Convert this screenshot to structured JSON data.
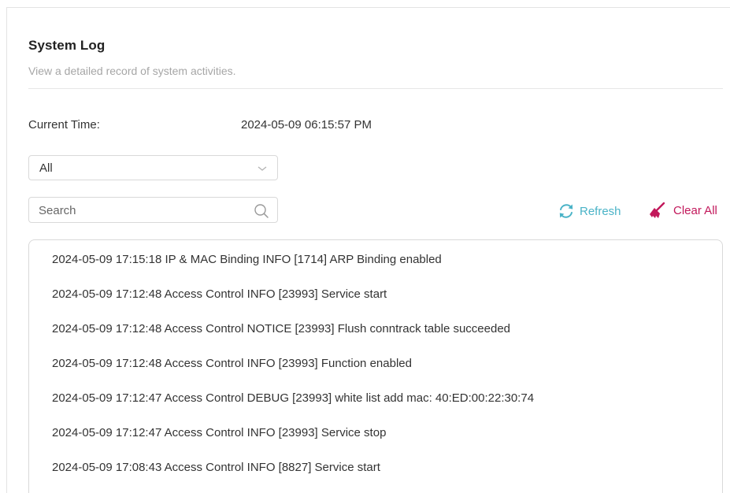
{
  "header": {
    "title": "System Log",
    "subtitle": "View a detailed record of system activities."
  },
  "current_time": {
    "label": "Current Time:",
    "value": "2024-05-09 06:15:57 PM"
  },
  "filter": {
    "selected": "All"
  },
  "search": {
    "placeholder": "Search",
    "value": ""
  },
  "actions": {
    "refresh_label": "Refresh",
    "clear_label": "Clear All"
  },
  "colors": {
    "refresh": "#4ab3c7",
    "clear": "#c2185b"
  },
  "icons": {
    "refresh": "refresh-icon",
    "clear": "broom-icon",
    "search": "search-icon",
    "dropdown": "chevron-down-icon"
  },
  "logs": [
    "2024-05-09 17:15:18 IP & MAC Binding INFO [1714] ARP Binding enabled",
    "2024-05-09 17:12:48 Access Control INFO [23993] Service start",
    "2024-05-09 17:12:48 Access Control NOTICE [23993] Flush conntrack table succeeded",
    "2024-05-09 17:12:48 Access Control INFO [23993] Function enabled",
    "2024-05-09 17:12:47 Access Control DEBUG [23993] white list add mac: 40:ED:00:22:30:74",
    "2024-05-09 17:12:47 Access Control INFO [23993] Service stop",
    "2024-05-09 17:08:43 Access Control INFO [8827] Service start"
  ]
}
